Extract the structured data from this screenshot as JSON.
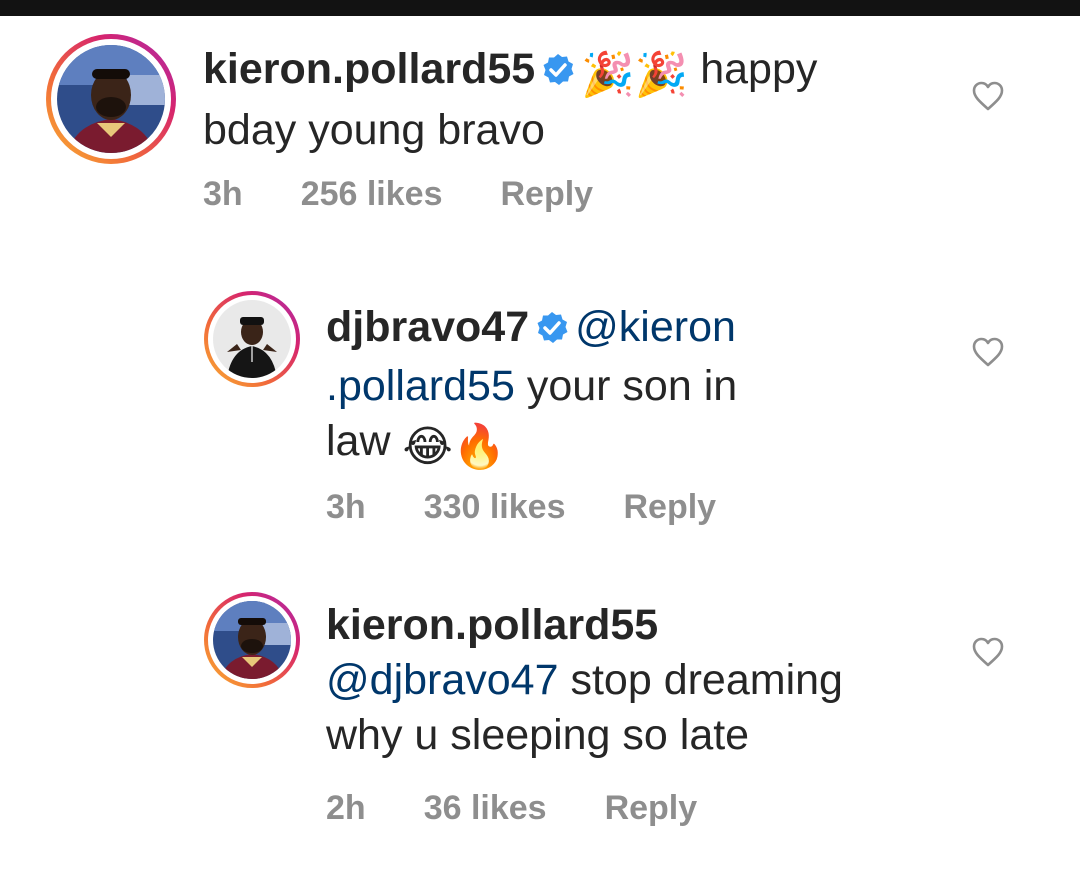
{
  "comments": [
    {
      "username": "kieron.pollard55",
      "verified": true,
      "emojis_before": "🎉🎉",
      "text_line1": "happy",
      "text_line2": "bday young bravo",
      "time": "3h",
      "likes": "256 likes",
      "reply": "Reply"
    },
    {
      "username": "djbravo47",
      "verified": true,
      "mention_part1": "@kieron",
      "mention_part2": ".pollard55",
      "text_line2_rest": "your son in",
      "text_line3": "law",
      "emojis_after": "😂🔥",
      "time": "3h",
      "likes": "330 likes",
      "reply": "Reply"
    },
    {
      "username": "kieron.pollard55",
      "verified": false,
      "mention": "@djbravo47",
      "text_line1_rest": "stop dreaming",
      "text_line2": "why u sleeping so late",
      "time": "2h",
      "likes": "36 likes",
      "reply": "Reply"
    }
  ],
  "icons": {
    "like": "heart-outline-icon",
    "verified": "verified-badge-icon"
  },
  "colors": {
    "text": "#262626",
    "meta": "#8e8e8e",
    "mention": "#00376b",
    "verified": "#3897f0"
  }
}
